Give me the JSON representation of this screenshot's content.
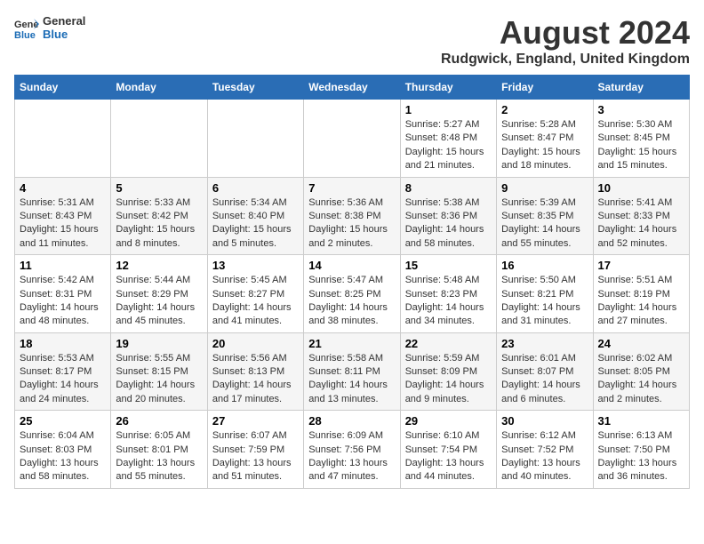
{
  "logo": {
    "line1": "General",
    "line2": "Blue"
  },
  "title": "August 2024",
  "subtitle": "Rudgwick, England, United Kingdom",
  "days_of_week": [
    "Sunday",
    "Monday",
    "Tuesday",
    "Wednesday",
    "Thursday",
    "Friday",
    "Saturday"
  ],
  "weeks": [
    [
      {
        "day": "",
        "info": ""
      },
      {
        "day": "",
        "info": ""
      },
      {
        "day": "",
        "info": ""
      },
      {
        "day": "",
        "info": ""
      },
      {
        "day": "1",
        "info": "Sunrise: 5:27 AM\nSunset: 8:48 PM\nDaylight: 15 hours\nand 21 minutes."
      },
      {
        "day": "2",
        "info": "Sunrise: 5:28 AM\nSunset: 8:47 PM\nDaylight: 15 hours\nand 18 minutes."
      },
      {
        "day": "3",
        "info": "Sunrise: 5:30 AM\nSunset: 8:45 PM\nDaylight: 15 hours\nand 15 minutes."
      }
    ],
    [
      {
        "day": "4",
        "info": "Sunrise: 5:31 AM\nSunset: 8:43 PM\nDaylight: 15 hours\nand 11 minutes."
      },
      {
        "day": "5",
        "info": "Sunrise: 5:33 AM\nSunset: 8:42 PM\nDaylight: 15 hours\nand 8 minutes."
      },
      {
        "day": "6",
        "info": "Sunrise: 5:34 AM\nSunset: 8:40 PM\nDaylight: 15 hours\nand 5 minutes."
      },
      {
        "day": "7",
        "info": "Sunrise: 5:36 AM\nSunset: 8:38 PM\nDaylight: 15 hours\nand 2 minutes."
      },
      {
        "day": "8",
        "info": "Sunrise: 5:38 AM\nSunset: 8:36 PM\nDaylight: 14 hours\nand 58 minutes."
      },
      {
        "day": "9",
        "info": "Sunrise: 5:39 AM\nSunset: 8:35 PM\nDaylight: 14 hours\nand 55 minutes."
      },
      {
        "day": "10",
        "info": "Sunrise: 5:41 AM\nSunset: 8:33 PM\nDaylight: 14 hours\nand 52 minutes."
      }
    ],
    [
      {
        "day": "11",
        "info": "Sunrise: 5:42 AM\nSunset: 8:31 PM\nDaylight: 14 hours\nand 48 minutes."
      },
      {
        "day": "12",
        "info": "Sunrise: 5:44 AM\nSunset: 8:29 PM\nDaylight: 14 hours\nand 45 minutes."
      },
      {
        "day": "13",
        "info": "Sunrise: 5:45 AM\nSunset: 8:27 PM\nDaylight: 14 hours\nand 41 minutes."
      },
      {
        "day": "14",
        "info": "Sunrise: 5:47 AM\nSunset: 8:25 PM\nDaylight: 14 hours\nand 38 minutes."
      },
      {
        "day": "15",
        "info": "Sunrise: 5:48 AM\nSunset: 8:23 PM\nDaylight: 14 hours\nand 34 minutes."
      },
      {
        "day": "16",
        "info": "Sunrise: 5:50 AM\nSunset: 8:21 PM\nDaylight: 14 hours\nand 31 minutes."
      },
      {
        "day": "17",
        "info": "Sunrise: 5:51 AM\nSunset: 8:19 PM\nDaylight: 14 hours\nand 27 minutes."
      }
    ],
    [
      {
        "day": "18",
        "info": "Sunrise: 5:53 AM\nSunset: 8:17 PM\nDaylight: 14 hours\nand 24 minutes."
      },
      {
        "day": "19",
        "info": "Sunrise: 5:55 AM\nSunset: 8:15 PM\nDaylight: 14 hours\nand 20 minutes."
      },
      {
        "day": "20",
        "info": "Sunrise: 5:56 AM\nSunset: 8:13 PM\nDaylight: 14 hours\nand 17 minutes."
      },
      {
        "day": "21",
        "info": "Sunrise: 5:58 AM\nSunset: 8:11 PM\nDaylight: 14 hours\nand 13 minutes."
      },
      {
        "day": "22",
        "info": "Sunrise: 5:59 AM\nSunset: 8:09 PM\nDaylight: 14 hours\nand 9 minutes."
      },
      {
        "day": "23",
        "info": "Sunrise: 6:01 AM\nSunset: 8:07 PM\nDaylight: 14 hours\nand 6 minutes."
      },
      {
        "day": "24",
        "info": "Sunrise: 6:02 AM\nSunset: 8:05 PM\nDaylight: 14 hours\nand 2 minutes."
      }
    ],
    [
      {
        "day": "25",
        "info": "Sunrise: 6:04 AM\nSunset: 8:03 PM\nDaylight: 13 hours\nand 58 minutes."
      },
      {
        "day": "26",
        "info": "Sunrise: 6:05 AM\nSunset: 8:01 PM\nDaylight: 13 hours\nand 55 minutes."
      },
      {
        "day": "27",
        "info": "Sunrise: 6:07 AM\nSunset: 7:59 PM\nDaylight: 13 hours\nand 51 minutes."
      },
      {
        "day": "28",
        "info": "Sunrise: 6:09 AM\nSunset: 7:56 PM\nDaylight: 13 hours\nand 47 minutes."
      },
      {
        "day": "29",
        "info": "Sunrise: 6:10 AM\nSunset: 7:54 PM\nDaylight: 13 hours\nand 44 minutes."
      },
      {
        "day": "30",
        "info": "Sunrise: 6:12 AM\nSunset: 7:52 PM\nDaylight: 13 hours\nand 40 minutes."
      },
      {
        "day": "31",
        "info": "Sunrise: 6:13 AM\nSunset: 7:50 PM\nDaylight: 13 hours\nand 36 minutes."
      }
    ]
  ]
}
